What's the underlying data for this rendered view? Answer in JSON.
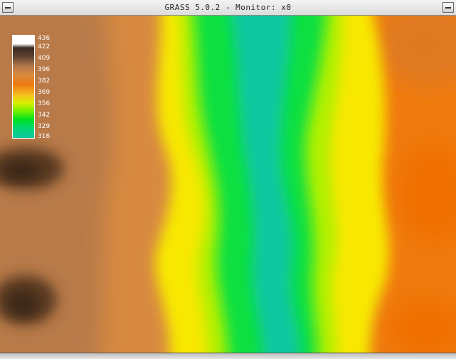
{
  "window": {
    "title": "GRASS 5.0.2 - Monitor: x0"
  },
  "legend": {
    "labels": [
      "436",
      "422",
      "409",
      "396",
      "382",
      "369",
      "356",
      "342",
      "329",
      "316"
    ]
  },
  "colors": {
    "high": "#3a2a20",
    "brown": "#b87a48",
    "orange": "#f07a10",
    "yellow": "#f8f000",
    "green": "#00e020",
    "teal": "#10c8a0"
  }
}
